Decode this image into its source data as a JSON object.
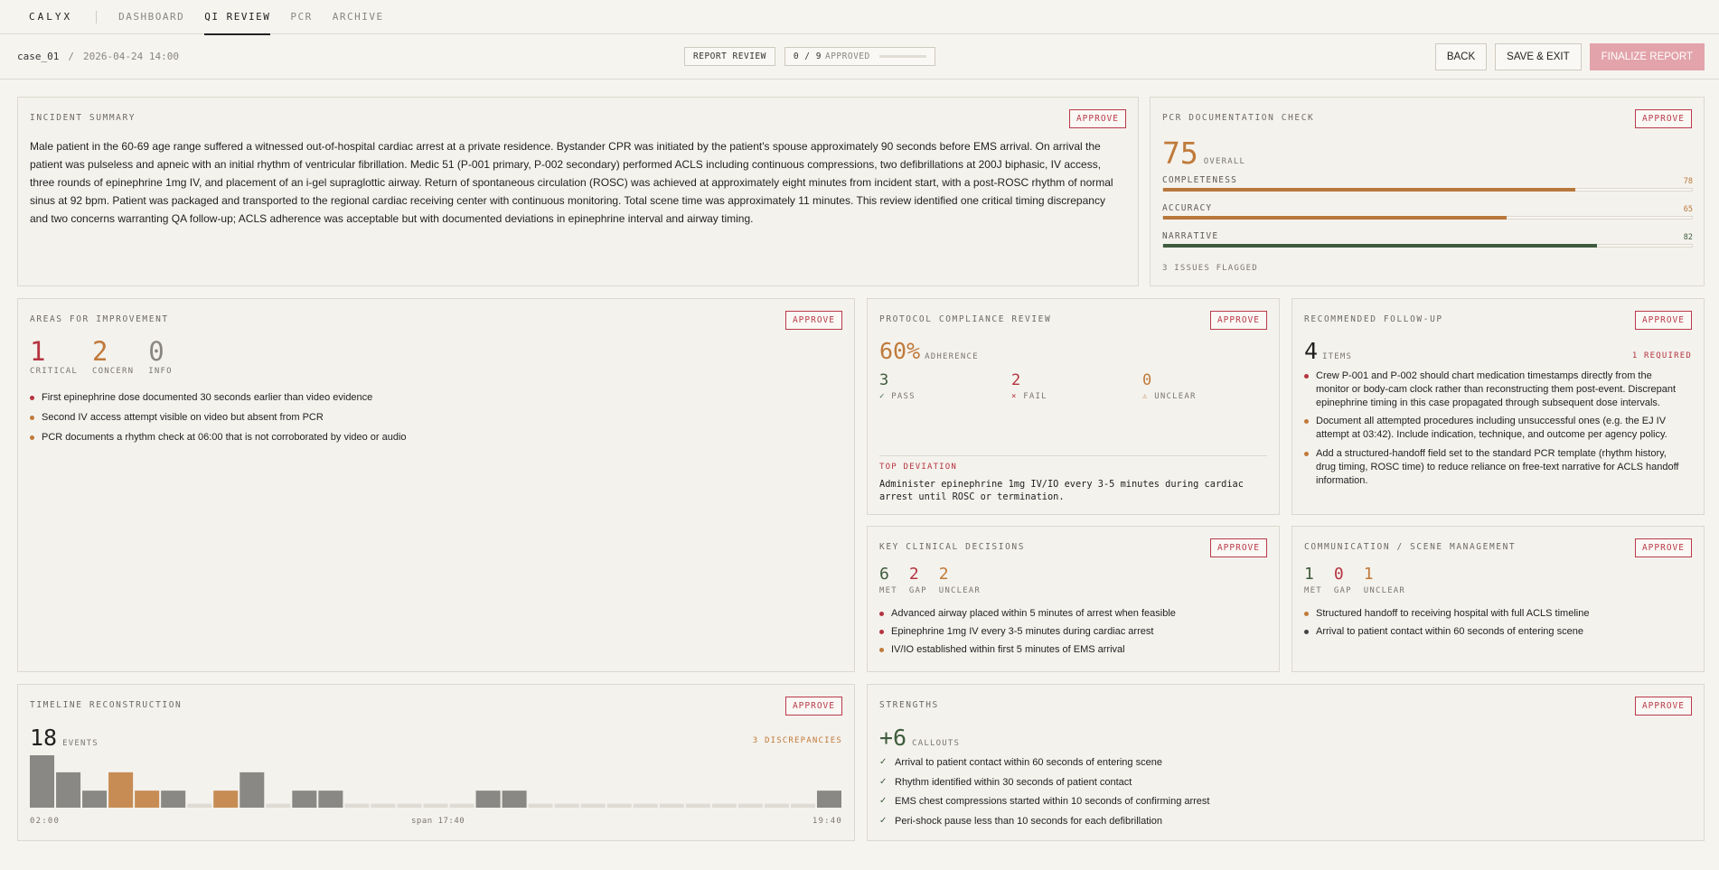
{
  "nav": {
    "brand": "CALYX",
    "items": [
      "DASHBOARD",
      "QI REVIEW",
      "PCR",
      "ARCHIVE"
    ]
  },
  "subheader": {
    "case_id": "case_01",
    "separator": "/",
    "datetime": "2026-04-24 14:00",
    "report_review": "REPORT REVIEW",
    "approved_count": "0 / 9",
    "approved_label": "APPROVED",
    "approved_fraction": 0,
    "back": "BACK",
    "save_exit": "SAVE & EXIT",
    "finalize": "FINALIZE REPORT"
  },
  "approve_label": "APPROVE",
  "incident": {
    "title": "INCIDENT SUMMARY",
    "text": "Male patient in the 60-69 age range suffered a witnessed out-of-hospital cardiac arrest at a private residence. Bystander CPR was initiated by the patient's spouse approximately 90 seconds before EMS arrival. On arrival the patient was pulseless and apneic with an initial rhythm of ventricular fibrillation. Medic 51 (P-001 primary, P-002 secondary) performed ACLS including continuous compressions, two defibrillations at 200J biphasic, IV access, three rounds of epinephrine 1mg IV, and placement of an i-gel supraglottic airway. Return of spontaneous circulation (ROSC) was achieved at approximately eight minutes from incident start, with a post-ROSC rhythm of normal sinus at 92 bpm. Patient was packaged and transported to the regional cardiac receiving center with continuous monitoring. Total scene time was approximately 11 minutes. This review identified one critical timing discrepancy and two concerns warranting QA follow-up; ACLS adherence was acceptable but with documented deviations in epinephrine interval and airway timing."
  },
  "pcr": {
    "title": "PCR DOCUMENTATION CHECK",
    "overall": "75",
    "overall_label": "OVERALL",
    "metrics": [
      {
        "label": "COMPLETENESS",
        "value": "78",
        "fraction": 0.78,
        "color": "#b8773b"
      },
      {
        "label": "ACCURACY",
        "value": "65",
        "fraction": 0.65,
        "color": "#b8773b"
      },
      {
        "label": "NARRATIVE",
        "value": "82",
        "fraction": 0.82,
        "color": "#3e5c3c"
      }
    ],
    "issues": "3 ISSUES FLAGGED"
  },
  "improvement": {
    "title": "AREAS FOR IMPROVEMENT",
    "critical": "1",
    "critical_label": "CRITICAL",
    "concern": "2",
    "concern_label": "CONCERN",
    "info": "0",
    "info_label": "INFO",
    "items": [
      {
        "text": "First epinephrine dose documented 30 seconds earlier than video evidence",
        "color": "#b5343f"
      },
      {
        "text": "Second IV access attempt visible on video but absent from PCR",
        "color": "#c07a3a"
      },
      {
        "text": "PCR documents a rhythm check at 06:00 that is not corroborated by video or audio",
        "color": "#c07a3a"
      }
    ]
  },
  "protocol": {
    "title": "PROTOCOL COMPLIANCE REVIEW",
    "adherence": "60%",
    "adherence_label": "ADHERENCE",
    "pass": "3",
    "pass_label": "PASS",
    "fail": "2",
    "fail_label": "FAIL",
    "unclear": "0",
    "unclear_label": "UNCLEAR",
    "top_label": "TOP DEVIATION",
    "top_text": "Administer epinephrine 1mg IV/IO every 3-5 minutes during cardiac arrest until ROSC or termination."
  },
  "followup": {
    "title": "RECOMMENDED FOLLOW-UP",
    "count": "4",
    "count_label": "ITEMS",
    "required": "1 REQUIRED",
    "items": [
      {
        "text": "Crew P-001 and P-002 should chart medication timestamps directly from the monitor or body-cam clock rather than reconstructing them post-event. Discrepant epinephrine timing in this case propagated through subsequent dose intervals.",
        "color": "#b5343f"
      },
      {
        "text": "Document all attempted procedures including unsuccessful ones (e.g. the EJ IV attempt at 03:42). Include indication, technique, and outcome per agency policy.",
        "color": "#c07a3a"
      },
      {
        "text": "Add a structured-handoff field set to the standard PCR template (rhythm history, drug timing, ROSC time) to reduce reliance on free-text narrative for ACLS handoff information.",
        "color": "#c07a3a"
      }
    ]
  },
  "decisions": {
    "title": "KEY CLINICAL DECISIONS",
    "met": "6",
    "met_label": "MET",
    "gap": "2",
    "gap_label": "GAP",
    "unclear": "2",
    "unclear_label": "UNCLEAR",
    "items": [
      {
        "text": "Advanced airway placed within 5 minutes of arrest when feasible",
        "color": "#b5343f"
      },
      {
        "text": "Epinephrine 1mg IV every 3-5 minutes during cardiac arrest",
        "color": "#b5343f"
      },
      {
        "text": "IV/IO established within first 5 minutes of EMS arrival",
        "color": "#c07a3a"
      }
    ]
  },
  "communication": {
    "title": "COMMUNICATION / SCENE MANAGEMENT",
    "met": "1",
    "met_label": "MET",
    "gap": "0",
    "gap_label": "GAP",
    "unclear": "1",
    "unclear_label": "UNCLEAR",
    "items": [
      {
        "text": "Structured handoff to receiving hospital with full ACLS timeline",
        "color": "#c07a3a"
      },
      {
        "text": "Arrival to patient contact within 60 seconds of entering scene",
        "color": "#444444"
      }
    ]
  },
  "timeline": {
    "title": "TIMELINE RECONSTRUCTION",
    "events": "18",
    "events_label": "EVENTS",
    "discrepancies": "3 DISCREPANCIES",
    "start": "02:00",
    "span": "span 17:40",
    "end": "19:40",
    "bars": [
      {
        "v": 4,
        "k": "n"
      },
      {
        "v": 2.7,
        "k": "n"
      },
      {
        "v": 1.3,
        "k": "n"
      },
      {
        "v": 2.7,
        "k": "d"
      },
      {
        "v": 1.3,
        "k": "d"
      },
      {
        "v": 1.3,
        "k": "n"
      },
      {
        "v": 0.3,
        "k": "e"
      },
      {
        "v": 1.3,
        "k": "d"
      },
      {
        "v": 2.7,
        "k": "n"
      },
      {
        "v": 0.3,
        "k": "e"
      },
      {
        "v": 1.3,
        "k": "n"
      },
      {
        "v": 1.3,
        "k": "n"
      },
      {
        "v": 0.3,
        "k": "e"
      },
      {
        "v": 0.3,
        "k": "e"
      },
      {
        "v": 0.3,
        "k": "e"
      },
      {
        "v": 0.3,
        "k": "e"
      },
      {
        "v": 0.3,
        "k": "e"
      },
      {
        "v": 1.3,
        "k": "n"
      },
      {
        "v": 1.3,
        "k": "n"
      },
      {
        "v": 0.3,
        "k": "e"
      },
      {
        "v": 0.3,
        "k": "e"
      },
      {
        "v": 0.3,
        "k": "e"
      },
      {
        "v": 0.3,
        "k": "e"
      },
      {
        "v": 0.3,
        "k": "e"
      },
      {
        "v": 0.3,
        "k": "e"
      },
      {
        "v": 0.3,
        "k": "e"
      },
      {
        "v": 0.3,
        "k": "e"
      },
      {
        "v": 0.3,
        "k": "e"
      },
      {
        "v": 0.3,
        "k": "e"
      },
      {
        "v": 0.3,
        "k": "e"
      },
      {
        "v": 1.3,
        "k": "n"
      }
    ]
  },
  "strengths": {
    "title": "STRENGTHS",
    "count": "+6",
    "count_label": "CALLOUTS",
    "items": [
      "Arrival to patient contact within 60 seconds of entering scene",
      "Rhythm identified within 30 seconds of patient contact",
      "EMS chest compressions started within 10 seconds of confirming arrest",
      "Peri-shock pause less than 10 seconds for each defibrillation"
    ]
  }
}
